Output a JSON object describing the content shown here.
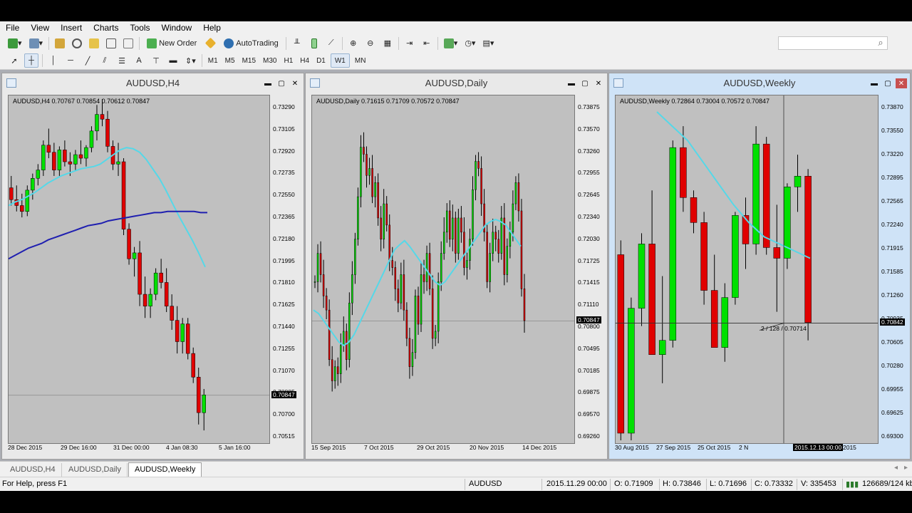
{
  "menu": [
    "File",
    "View",
    "Insert",
    "Charts",
    "Tools",
    "Window",
    "Help"
  ],
  "toolbar": {
    "new_order": "New Order",
    "autotrading": "AutoTrading",
    "timeframes": [
      "M1",
      "M5",
      "M15",
      "M30",
      "H1",
      "H4",
      "D1",
      "W1",
      "MN"
    ],
    "active_timeframe": "W1",
    "search_placeholder": ""
  },
  "windows": [
    {
      "title": "AUDUSD,H4",
      "info": "AUDUSD,H4  0.70767 0.70854 0.70612 0.70847",
      "prices": [
        "0.73290",
        "0.73105",
        "0.72920",
        "0.72735",
        "0.72550",
        "0.72365",
        "0.72180",
        "0.71995",
        "0.71810",
        "0.71625",
        "0.71440",
        "0.71255",
        "0.71070",
        "0.70885",
        "0.70700",
        "0.70515"
      ],
      "current_price": "0.70847",
      "dates": [
        "28 Dec 2015",
        "29 Dec 16:00",
        "31 Dec 00:00",
        "4 Jan 08:30",
        "5 Jan 16:00"
      ]
    },
    {
      "title": "AUDUSD,Daily",
      "info": "AUDUSD,Daily  0.71615 0.71709 0.70572 0.70847",
      "prices": [
        "0.73875",
        "0.73570",
        "0.73260",
        "0.72955",
        "0.72645",
        "0.72340",
        "0.72030",
        "0.71725",
        "0.71415",
        "0.71110",
        "0.70800",
        "0.70495",
        "0.70185",
        "0.69875",
        "0.69570",
        "0.69260"
      ],
      "current_price": "0.70847",
      "dates": [
        "15 Sep 2015",
        "7 Oct 2015",
        "29 Oct 2015",
        "20 Nov 2015",
        "14 Dec 2015"
      ]
    },
    {
      "title": "AUDUSD,Weekly",
      "info": "AUDUSD,Weekly  0.72864 0.73004 0.70572 0.70847",
      "prices": [
        "0.73870",
        "0.73550",
        "0.73220",
        "0.72895",
        "0.72565",
        "0.72240",
        "0.71915",
        "0.71585",
        "0.71260",
        "0.70935",
        "0.70605",
        "0.70280",
        "0.69955",
        "0.69625",
        "0.69300"
      ],
      "current_price": "0.70842",
      "dates": [
        "30 Aug 2015",
        "27 Sep 2015",
        "25 Oct 2015",
        "2 N",
        "2015.12.13 00:00",
        "2015"
      ],
      "crosshair_label": "2 / 128 / 0.70714"
    }
  ],
  "tabs": [
    "AUDUSD,H4",
    "AUDUSD,Daily",
    "AUDUSD,Weekly"
  ],
  "active_tab": "AUDUSD,Weekly",
  "status": {
    "help": "For Help, press F1",
    "symbol": "AUDUSD",
    "datetime": "2015.11.29 00:00",
    "open": "O: 0.71909",
    "high": "H: 0.73846",
    "low": "L: 0.71696",
    "close": "C: 0.73332",
    "volume": "V: 335453",
    "traffic": "126689/124 kb"
  },
  "colors": {
    "bull": "#00e000",
    "bear": "#e00000",
    "ma_fast": "#55d8e8",
    "ma_slow": "#1f1fb0",
    "chart_bg": "#c0c0c0"
  },
  "chart_data": [
    {
      "type": "candlestick",
      "symbol": "AUDUSD",
      "timeframe": "H4",
      "ylim": [
        0.7043,
        0.7338
      ],
      "candles": [
        [
          0.726,
          0.727,
          0.7245,
          0.725
        ],
        [
          0.725,
          0.7262,
          0.724,
          0.7245
        ],
        [
          0.7245,
          0.7255,
          0.7235,
          0.724
        ],
        [
          0.724,
          0.7262,
          0.7236,
          0.7258
        ],
        [
          0.7258,
          0.7272,
          0.725,
          0.7268
        ],
        [
          0.7268,
          0.728,
          0.7262,
          0.7275
        ],
        [
          0.7275,
          0.73,
          0.727,
          0.7296
        ],
        [
          0.7296,
          0.731,
          0.7285,
          0.729
        ],
        [
          0.729,
          0.7298,
          0.727,
          0.7275
        ],
        [
          0.7275,
          0.7295,
          0.727,
          0.7292
        ],
        [
          0.7292,
          0.73,
          0.7278,
          0.7282
        ],
        [
          0.7282,
          0.729,
          0.727,
          0.728
        ],
        [
          0.728,
          0.7292,
          0.7275,
          0.7288
        ],
        [
          0.7288,
          0.73,
          0.728,
          0.7285
        ],
        [
          0.7285,
          0.7296,
          0.7278,
          0.7294
        ],
        [
          0.7294,
          0.7312,
          0.729,
          0.7308
        ],
        [
          0.7308,
          0.733,
          0.73,
          0.7322
        ],
        [
          0.7322,
          0.7335,
          0.7312,
          0.7318
        ],
        [
          0.7318,
          0.7325,
          0.729,
          0.7295
        ],
        [
          0.7295,
          0.73,
          0.7275,
          0.728
        ],
        [
          0.728,
          0.7298,
          0.727,
          0.7282
        ],
        [
          0.7282,
          0.7285,
          0.722,
          0.7225
        ],
        [
          0.7225,
          0.723,
          0.7195,
          0.72
        ],
        [
          0.72,
          0.721,
          0.7185,
          0.7205
        ],
        [
          0.7205,
          0.7215,
          0.716,
          0.717
        ],
        [
          0.717,
          0.7185,
          0.715,
          0.716
        ],
        [
          0.716,
          0.7175,
          0.715,
          0.717
        ],
        [
          0.717,
          0.7192,
          0.7165,
          0.7188
        ],
        [
          0.7188,
          0.72,
          0.7175,
          0.718
        ],
        [
          0.718,
          0.7192,
          0.7155,
          0.716
        ],
        [
          0.716,
          0.717,
          0.714,
          0.7148
        ],
        [
          0.7148,
          0.716,
          0.712,
          0.713
        ],
        [
          0.713,
          0.715,
          0.712,
          0.7145
        ],
        [
          0.7145,
          0.715,
          0.7115,
          0.712
        ],
        [
          0.712,
          0.7125,
          0.7095,
          0.71
        ],
        [
          0.71,
          0.7108,
          0.706,
          0.707
        ],
        [
          0.707,
          0.709,
          0.7055,
          0.7085
        ]
      ],
      "ma_fast": [
        0.7245,
        0.7248,
        0.725,
        0.7253,
        0.7256,
        0.726,
        0.7264,
        0.7267,
        0.727,
        0.7272,
        0.7274,
        0.7276,
        0.7277,
        0.7278,
        0.728,
        0.7284,
        0.7288,
        0.7292,
        0.7294,
        0.7293,
        0.729,
        0.7284,
        0.7276,
        0.7268,
        0.7258,
        0.7247,
        0.7236,
        0.7226,
        0.7216,
        0.7205,
        0.7193
      ],
      "ma_slow": [
        0.72,
        0.7203,
        0.7206,
        0.7209,
        0.7211,
        0.7213,
        0.7216,
        0.7218,
        0.722,
        0.7222,
        0.7224,
        0.7226,
        0.7228,
        0.7229,
        0.723,
        0.7232,
        0.7233,
        0.7234,
        0.7235,
        0.7236,
        0.7237,
        0.7238,
        0.7239,
        0.7239,
        0.724,
        0.724,
        0.724,
        0.724,
        0.724,
        0.7239,
        0.7239
      ],
      "current_price": 0.70847
    },
    {
      "type": "candlestick",
      "symbol": "AUDUSD",
      "timeframe": "Daily",
      "ylim": [
        0.691,
        0.7403
      ],
      "series_close": [
        0.714,
        0.718,
        0.715,
        0.712,
        0.71,
        0.703,
        0.7,
        0.702,
        0.701,
        0.705,
        0.707,
        0.703,
        0.711,
        0.715,
        0.72,
        0.726,
        0.733,
        0.732,
        0.729,
        0.73,
        0.726,
        0.728,
        0.723,
        0.72,
        0.725,
        0.722,
        0.717,
        0.716,
        0.713,
        0.711,
        0.715,
        0.71,
        0.706,
        0.702,
        0.704,
        0.712,
        0.708,
        0.715,
        0.714,
        0.718,
        0.713,
        0.706,
        0.707,
        0.714,
        0.718,
        0.721,
        0.724,
        0.72,
        0.723,
        0.718,
        0.723,
        0.721,
        0.716,
        0.717,
        0.72,
        0.727,
        0.731,
        0.73,
        0.725,
        0.721,
        0.714,
        0.718,
        0.721,
        0.72,
        0.718,
        0.723,
        0.715,
        0.719,
        0.721,
        0.725,
        0.728,
        0.724,
        0.713,
        0.7085
      ],
      "ma_fast": [
        0.71,
        0.7095,
        0.7085,
        0.7075,
        0.7065,
        0.7055,
        0.705,
        0.7055,
        0.7065,
        0.708,
        0.7095,
        0.711,
        0.7125,
        0.714,
        0.7155,
        0.717,
        0.7185,
        0.7192,
        0.7198,
        0.719,
        0.718,
        0.717,
        0.716,
        0.715,
        0.714,
        0.7135,
        0.714,
        0.715,
        0.716,
        0.717,
        0.718,
        0.719,
        0.72,
        0.721,
        0.722,
        0.7225,
        0.7228,
        0.7225,
        0.722,
        0.721,
        0.72,
        0.719
      ],
      "current_price": 0.70847
    },
    {
      "type": "candlestick",
      "symbol": "AUDUSD",
      "timeframe": "Weekly",
      "ylim": [
        0.6914,
        0.7403
      ],
      "candles": [
        [
          0.718,
          0.72,
          0.692,
          0.693
        ],
        [
          0.693,
          0.712,
          0.692,
          0.7105
        ],
        [
          0.7105,
          0.721,
          0.708,
          0.7195
        ],
        [
          0.7195,
          0.727,
          0.71,
          0.704
        ],
        [
          0.704,
          0.715,
          0.7,
          0.706
        ],
        [
          0.706,
          0.734,
          0.705,
          0.733
        ],
        [
          0.733,
          0.736,
          0.724,
          0.726
        ],
        [
          0.726,
          0.727,
          0.721,
          0.7225
        ],
        [
          0.7225,
          0.724,
          0.711,
          0.713
        ],
        [
          0.713,
          0.718,
          0.708,
          0.705
        ],
        [
          0.705,
          0.714,
          0.703,
          0.712
        ],
        [
          0.712,
          0.724,
          0.711,
          0.7235
        ],
        [
          0.7235,
          0.726,
          0.716,
          0.7195
        ],
        [
          0.7195,
          0.736,
          0.718,
          0.7335
        ],
        [
          0.7335,
          0.7345,
          0.718,
          0.719
        ],
        [
          0.719,
          0.725,
          0.71,
          0.7175
        ],
        [
          0.7175,
          0.728,
          0.716,
          0.7275
        ],
        [
          0.7275,
          0.732,
          0.724,
          0.729
        ],
        [
          0.729,
          0.73,
          0.706,
          0.7085
        ]
      ],
      "ma_fast": [
        0.738,
        0.736,
        0.734,
        0.731,
        0.728,
        0.725,
        0.7225,
        0.7205,
        0.7195,
        0.7185,
        0.7175
      ],
      "current_price": 0.70842
    }
  ]
}
